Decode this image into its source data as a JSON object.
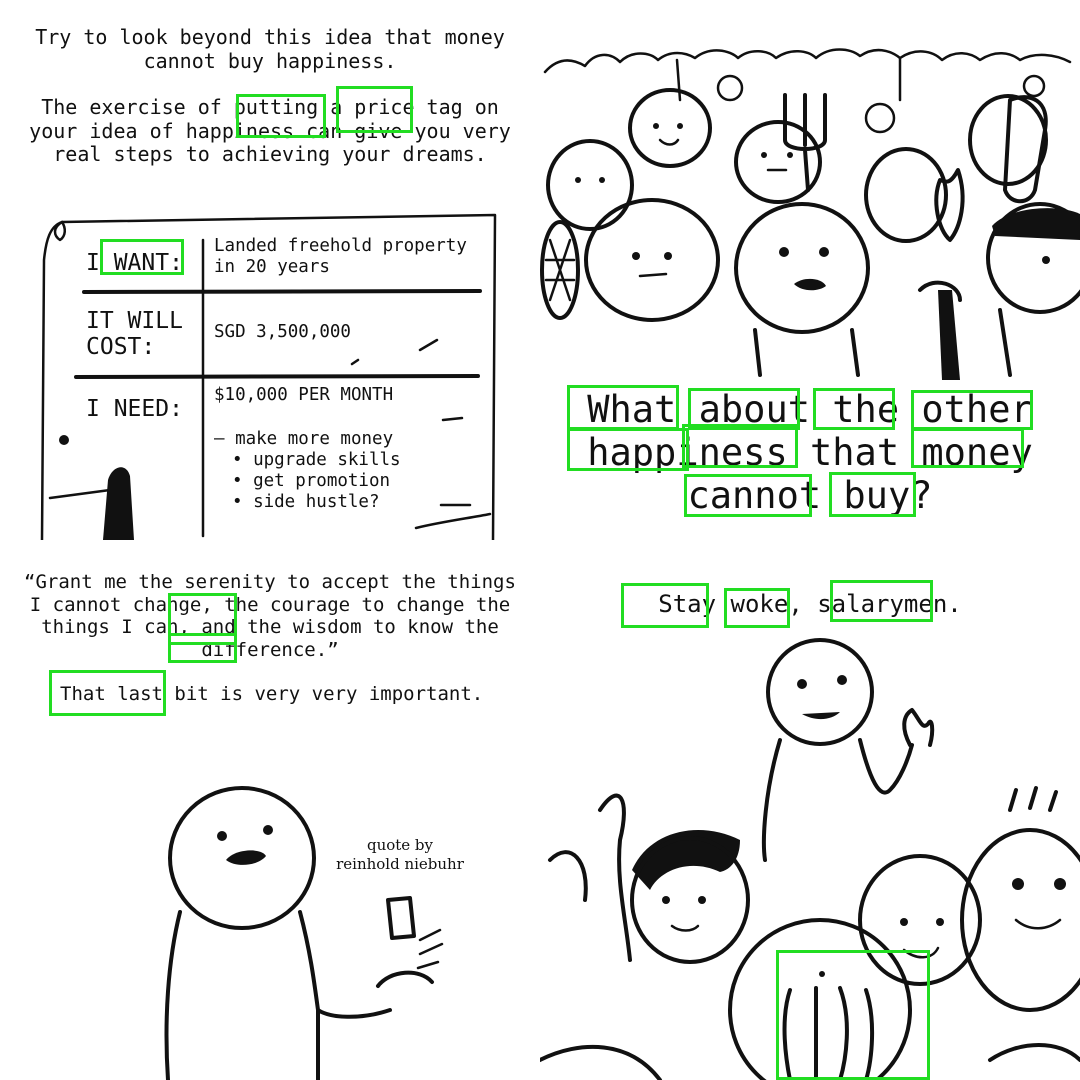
{
  "panel1": {
    "intro": "Try to look beyond this idea that money cannot buy happiness.",
    "exercise": "The exercise of putting a price tag on your idea of happiness can give you very real steps to achieving your dreams.",
    "table": {
      "want_label": "I WANT:",
      "want_value": "Landed freehold property in 20 years",
      "cost_label": "IT WILL COST:",
      "cost_value": "SGD 3,500,000",
      "need_label": "I NEED:",
      "need_value": "$10,000 PER MONTH",
      "need_main_item": "– make more money",
      "need_subitems": [
        "upgrade skills",
        "get promotion",
        "side hustle?"
      ]
    }
  },
  "panel2": {
    "caption": "What about the other happiness that money cannot buy?"
  },
  "panel3": {
    "quote": "“Grant me the serenity to accept the things I cannot change, the courage to change the things I can, and the wisdom to know the difference.”",
    "note": "That last bit is very very important.",
    "credit_line1": "quote by",
    "credit_line2": "reinhold niebuhr"
  },
  "panel4": {
    "caption": "Stay woke, salarymen."
  },
  "style": {
    "highlight_color": "#22dd22",
    "ink_color": "#111111",
    "background": "#ffffff"
  }
}
